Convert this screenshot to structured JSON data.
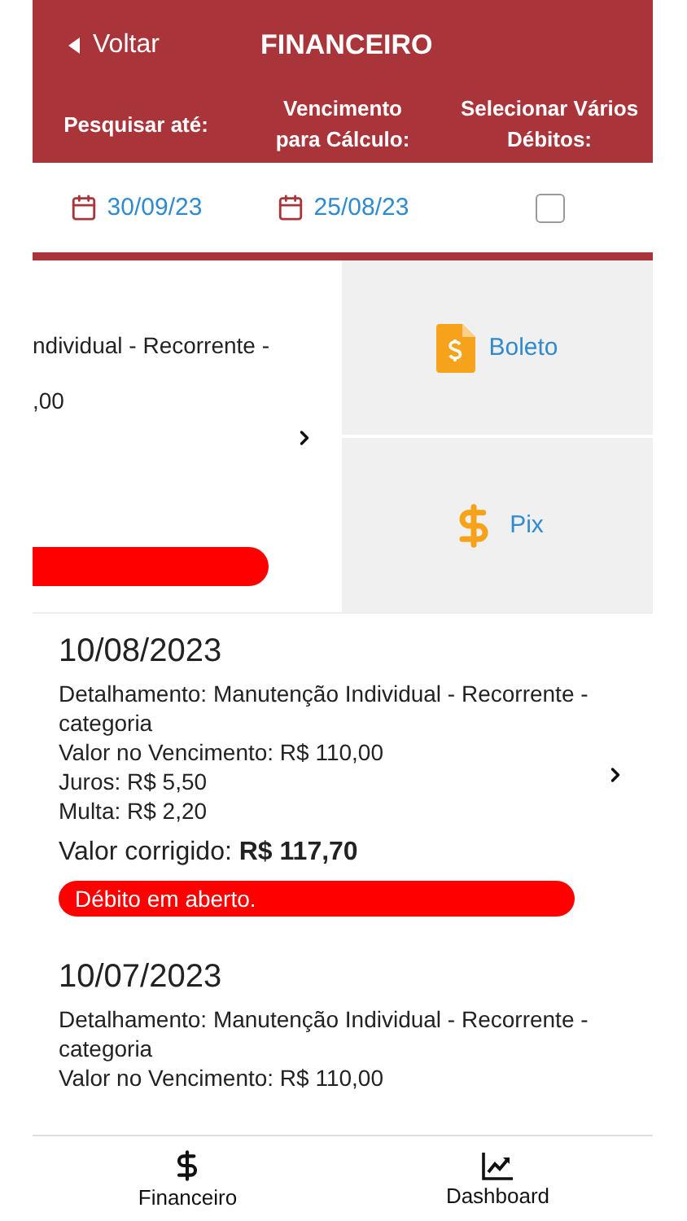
{
  "header": {
    "back_label": "Voltar",
    "title": "FINANCEIRO"
  },
  "filters": [
    {
      "kind": "date",
      "label": "Pesquisar até:",
      "value": "30/09/23"
    },
    {
      "kind": "date",
      "label": "Vencimento para Cálculo:",
      "value": "25/08/23"
    },
    {
      "kind": "checkbox",
      "label": "Selecionar Vários Débitos:",
      "checked": false
    }
  ],
  "swiped_debit": {
    "lines": [
      "ndividual - Recorrente -",
      ",00"
    ],
    "color": "#ff0000",
    "actions": [
      {
        "kind": "boleto",
        "label": "Boleto"
      },
      {
        "kind": "pix",
        "label": "Pix"
      }
    ]
  },
  "debits": [
    {
      "date": "10/08/2023",
      "details": [
        "Detalhamento: Manutenção Individual - Recorrente - categoria",
        "Valor no Vencimento: R$ 110,00",
        "Juros: R$ 5,50",
        "Multa: R$ 2,20"
      ],
      "corrected_label": "Valor corrigido:",
      "corrected_value": "R$ 117,70",
      "color": "#ff0000",
      "status_text": "Débito em aberto."
    },
    {
      "date": "10/07/2023",
      "details": [
        "Detalhamento: Manutenção Individual - Recorrente - categoria",
        "Valor no Vencimento: R$ 110,00"
      ]
    }
  ],
  "nav": [
    {
      "kind": "dollar",
      "label": "Financeiro"
    },
    {
      "kind": "chart",
      "label": "Dashboard"
    }
  ]
}
